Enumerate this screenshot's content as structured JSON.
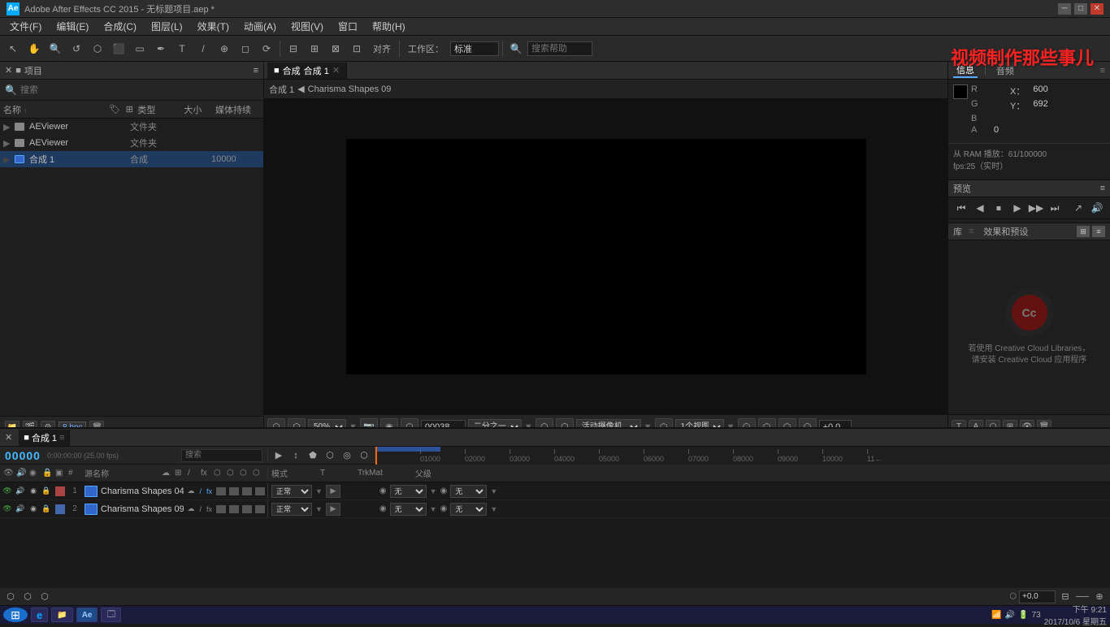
{
  "titlebar": {
    "title": "Adobe After Effects CC 2015 - 无标题项目.aep *",
    "icon_label": "Ai",
    "minimize": "─",
    "maximize": "□",
    "close": "✕"
  },
  "menubar": {
    "items": [
      "文件(F)",
      "编辑(E)",
      "合成(C)",
      "图层(L)",
      "效果(T)",
      "动画(A)",
      "视图(V)",
      "窗口",
      "帮助(H)"
    ]
  },
  "toolbar": {
    "align_label": "对齐",
    "workspace_label": "工作区：",
    "workspace_value": "标准",
    "search_placeholder": "搜索帮助"
  },
  "project_panel": {
    "title": "项目",
    "menu_icon": "≡",
    "search_placeholder": "搜索",
    "columns": {
      "name": "名称",
      "type": "类型",
      "size": "大小",
      "media": "媒体持续"
    },
    "files": [
      {
        "type": "folder",
        "indent": 1,
        "name": "AEViewer",
        "filetype": "文件夹",
        "size": "",
        "media": ""
      },
      {
        "type": "folder",
        "indent": 1,
        "name": "AEViewer",
        "filetype": "文件夹",
        "size": "",
        "media": ""
      },
      {
        "type": "comp",
        "indent": 0,
        "name": "合成 1",
        "filetype": "合成",
        "size": "",
        "media": "10000"
      }
    ],
    "footer": {
      "bpc": "8 bpc"
    }
  },
  "comp_panel": {
    "tabs": [
      {
        "label": "■ 合成",
        "active": true
      },
      {
        "label": "合成 1",
        "active": true
      }
    ],
    "breadcrumb": {
      "comp": "合成 1",
      "arrow": "◀",
      "child": "Charisma Shapes 09"
    },
    "controls": {
      "zoom": "50%",
      "time": "00038",
      "resolution": "二分之一",
      "camera": "活动摄像机",
      "views": "1个视图",
      "offset": "+0.0"
    }
  },
  "info_panel": {
    "tabs": [
      "信息",
      "音频"
    ],
    "menu": "≡",
    "color": {
      "r_label": "R",
      "g_label": "G",
      "b_label": "B",
      "a_label": "A",
      "r_value": "",
      "g_value": "",
      "b_value": "",
      "a_value": "0"
    },
    "coords": {
      "x_label": "X：",
      "x_value": "600",
      "y_label": "Y：",
      "y_value": "692"
    },
    "ram_text": "从 RAM 播放：61/100000",
    "fps_text": "fps:25（实时）"
  },
  "preview_panel": {
    "title": "预览",
    "menu": "≡",
    "buttons": [
      "⏮",
      "◀",
      "⏹",
      "▶",
      "⏭",
      "⏭"
    ],
    "extra_btn1": "↗",
    "extra_btn2": "🔊"
  },
  "effects_panel": {
    "title": "库",
    "menu": "≡",
    "subtitle": "效果和预设",
    "tab1": "效果和预设",
    "cc_text_line1": "若使用 Creative Cloud Libraries，",
    "cc_text_line2": "请安装 Creative Cloud 应用程序"
  },
  "timeline_panel": {
    "title": "合成 1",
    "tabs": [
      {
        "label": "■ 合成 1",
        "active": true
      }
    ],
    "time": "00000",
    "fps": "0:00:00:00 (25.00 fps)",
    "toolbar_btns": [
      "▶",
      "↕",
      "⬟",
      "⬡",
      "◎",
      "⬡"
    ],
    "layers": [
      {
        "num": "1",
        "name": "Charisma Shapes 04",
        "mode": "正常",
        "trk_mat": "无",
        "parent": "无",
        "color": "#aa4444"
      },
      {
        "num": "2",
        "name": "Charisma Shapes 09",
        "mode": "正常",
        "trk_mat": "无",
        "parent": "无",
        "color": "#4466aa"
      }
    ],
    "columns": [
      "#",
      "源名称",
      "模式",
      "T",
      "TrkMat",
      "父级"
    ],
    "offset_value": "+0.0"
  },
  "taskbar": {
    "start_icon": "⊞",
    "apps": [
      {
        "label": "IE",
        "icon": "e"
      },
      {
        "label": "Explorer",
        "icon": "📁"
      },
      {
        "label": "AE",
        "icon": "Ae"
      },
      {
        "label": "Window",
        "icon": "🗔"
      }
    ],
    "time": "下午 9:21",
    "date": "2017/10/6 星期五",
    "battery": "73"
  },
  "watermark": "视频制作那些事儿"
}
